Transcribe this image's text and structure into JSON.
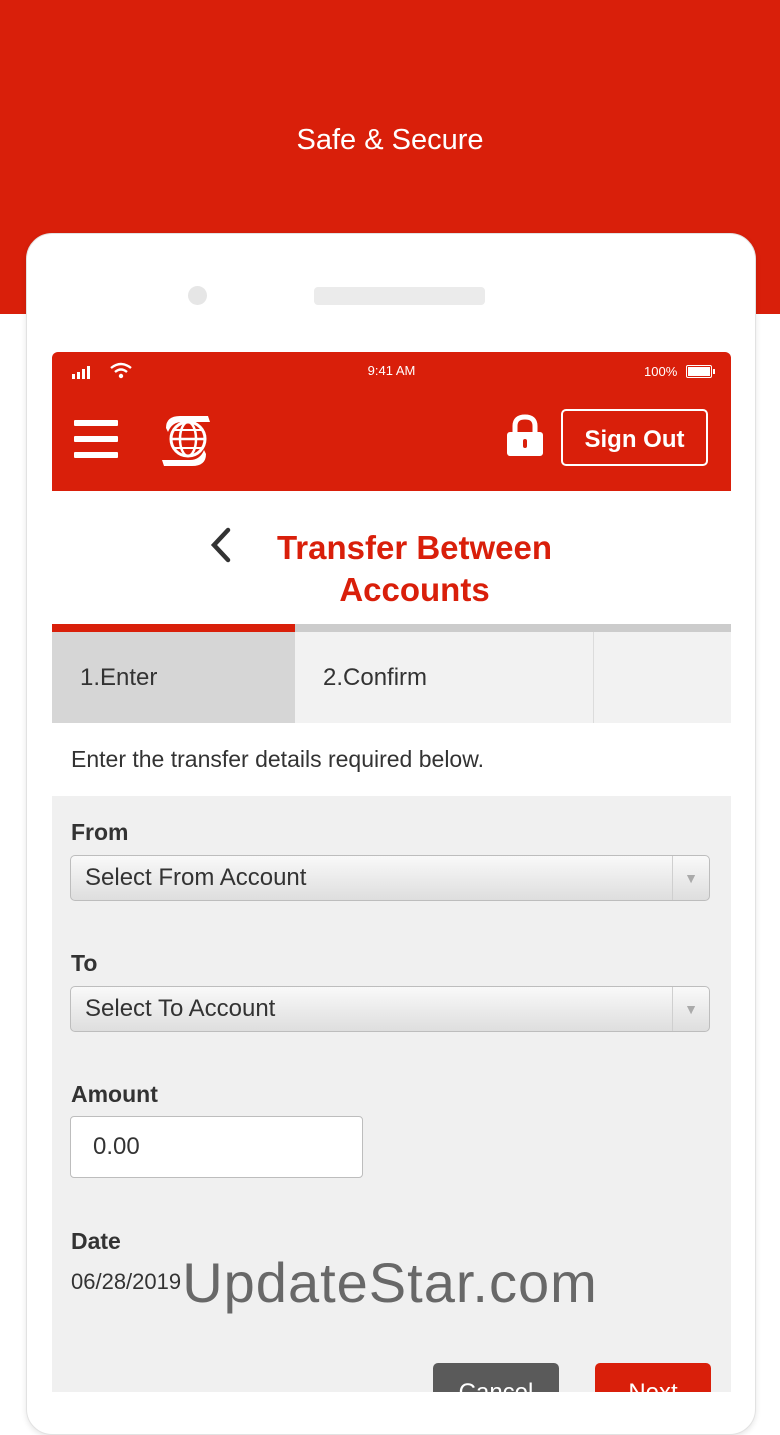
{
  "banner": {
    "tagline": "Safe & Secure"
  },
  "status_bar": {
    "time": "9:41 AM",
    "battery": "100%"
  },
  "header": {
    "sign_out_label": "Sign Out"
  },
  "page": {
    "title": "Transfer Between Accounts"
  },
  "steps": [
    {
      "label": "1.Enter",
      "active": true
    },
    {
      "label": "2.Confirm",
      "active": false
    }
  ],
  "form": {
    "intro": "Enter the transfer details required below.",
    "from_label": "From",
    "from_value": "Select From Account",
    "to_label": "To",
    "to_value": "Select To Account",
    "amount_label": "Amount",
    "amount_value": "0.00",
    "date_label": "Date",
    "date_value": "06/28/2019",
    "cancel_label": "Cancel",
    "next_label": "Next"
  },
  "watermark": "UpdateStar.com",
  "colors": {
    "brand_red": "#d91f0a",
    "step_active": "#d91f0a",
    "step_inactive": "#cccccc"
  },
  "icons": [
    "signal-icon",
    "wifi-icon",
    "battery-icon",
    "menu-icon",
    "scotiabank-logo",
    "lock-icon",
    "back-chevron-icon",
    "dropdown-arrow-icon"
  ]
}
